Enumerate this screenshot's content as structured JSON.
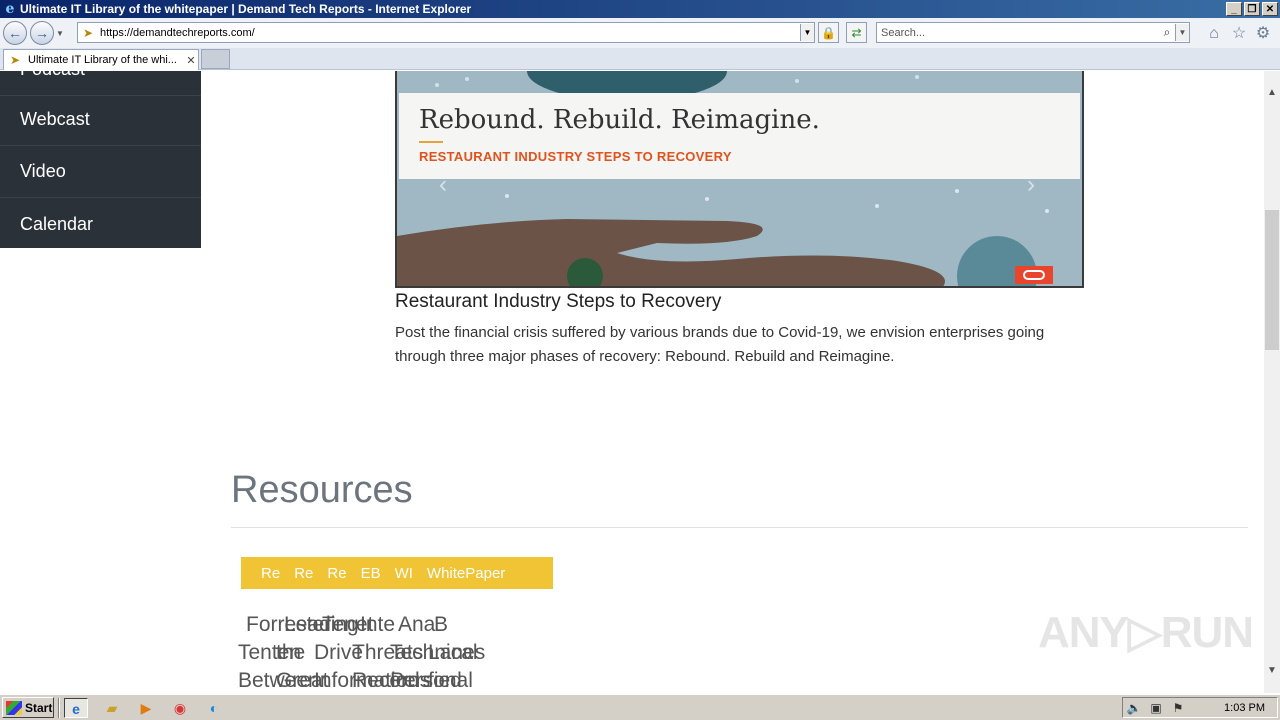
{
  "window": {
    "title": "Ultimate IT Library of the whitepaper | Demand Tech Reports - Internet Explorer",
    "controls": {
      "minimize": "_",
      "restore": "❐",
      "close": "✕"
    }
  },
  "navbar": {
    "url": "https://demandtechreports.com/",
    "search_placeholder": "Search..."
  },
  "tabs": [
    {
      "label": "Ultimate IT Library of the whi...",
      "close": "✕"
    }
  ],
  "sidebar": {
    "items": [
      {
        "label": "Podcast"
      },
      {
        "label": "Webcast"
      },
      {
        "label": "Video"
      },
      {
        "label": "Calendar"
      }
    ]
  },
  "banner": {
    "title": "Rebound. Rebuild. Reimagine.",
    "subtitle": "RESTAURANT INDUSTRY STEPS TO RECOVERY",
    "prev": "‹",
    "next": "›"
  },
  "article": {
    "title": "Restaurant Industry Steps to Recovery",
    "description": "Post the financial crisis suffered by various brands due to Covid-19, we envision enterprises going through three major phases of recovery: Rebound. Rebuild and Reimagine."
  },
  "resources": {
    "heading": "Resources",
    "filters": [
      "Re",
      "Re",
      "Re",
      "EB",
      "WI",
      "WhitePaper"
    ],
    "overlapping_text_rows": [
      [
        "Forrester",
        "Leading",
        "Tenet",
        "Inte",
        "Ana",
        "B"
      ],
      [
        "Tenten",
        "the",
        "Drive",
        "Threats",
        "Technical",
        "Lanes"
      ],
      [
        "Between",
        "Great",
        "Information",
        "Records",
        "Personal",
        "fied"
      ]
    ]
  },
  "watermark": "ANY▷RUN",
  "taskbar": {
    "start_label": "Start",
    "clock": "1:03 PM"
  }
}
